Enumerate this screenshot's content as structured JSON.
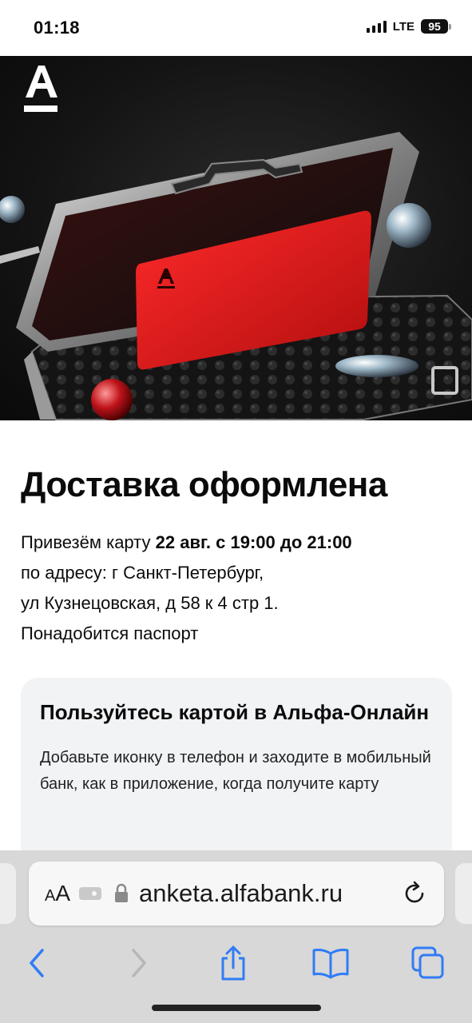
{
  "status_bar": {
    "time": "01:18",
    "network": "LTE",
    "battery": "95"
  },
  "hero": {
    "brand_logo": "A"
  },
  "delivery": {
    "title": "Доставка оформлена",
    "line1_prefix": "Привезём карту ",
    "line1_bold": "22 авг. с 19:00 до 21:00",
    "line2": "по адресу: г Санкт-Петербург,",
    "line3": "ул Кузнецовская, д 58 к 4 стр 1.",
    "line4": "Понадобится паспорт"
  },
  "promo_card": {
    "title": "Пользуйтесь картой в Альфа-Онлайн",
    "text": "Добавьте иконку в телефон и заходите в мобильный банк, как в приложение, когда получите карту"
  },
  "browser": {
    "text_size_label_small": "A",
    "text_size_label_large": "A",
    "url": "anketa.alfabank.ru",
    "icons": [
      "back-icon",
      "forward-icon",
      "share-icon",
      "bookmarks-icon",
      "tabs-icon",
      "reload-icon",
      "lock-icon"
    ],
    "accent_color": "#2f7cf6",
    "disabled_color": "#b7b7b7"
  },
  "colors": {
    "brand_red": "#e3121b",
    "hero_bg": "#141414",
    "card_bg": "#f2f3f5"
  }
}
